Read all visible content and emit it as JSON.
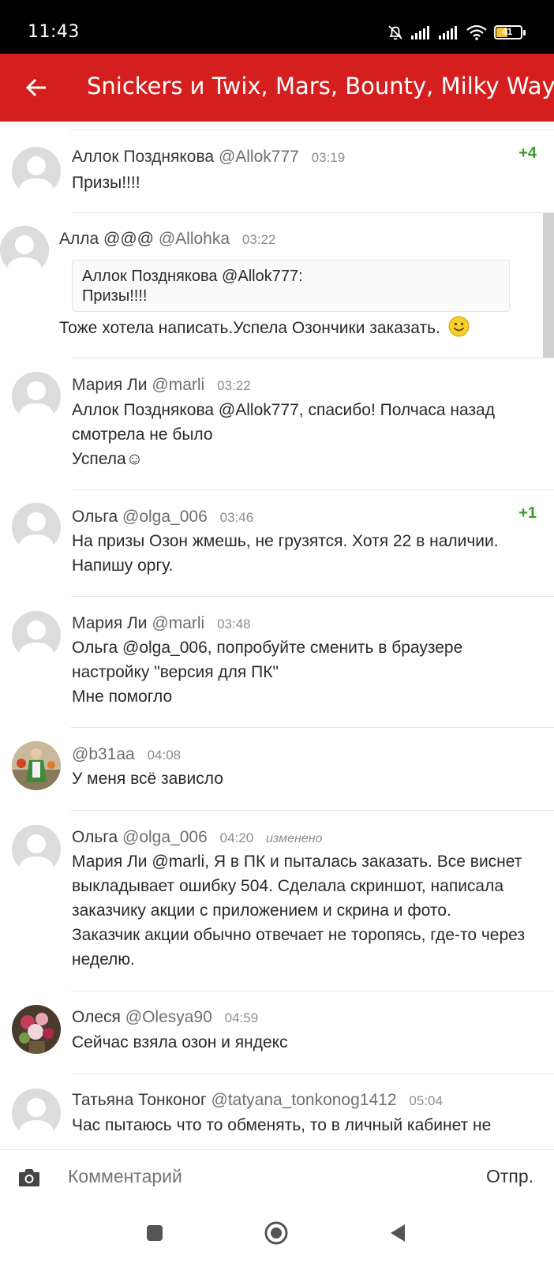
{
  "status_bar": {
    "time": "11:43",
    "battery": "41"
  },
  "header": {
    "title": "Snickers и Twix, Mars, Bounty, Milky Way"
  },
  "comments": [
    {
      "name": "Аллок Позднякова",
      "handle": "@Allok777",
      "time": "03:19",
      "rating": "+4",
      "text": "Призы!!!!"
    },
    {
      "name": "Алла @@@",
      "handle": "@Allohka",
      "time": "03:22",
      "quote": {
        "author": "Аллок Позднякова @Allok777:",
        "text": "Призы!!!!"
      },
      "text": "Тоже хотела написать.Успела Озончики заказать."
    },
    {
      "name": "Мария Ли",
      "handle": "@marli",
      "time": "03:22",
      "lines": [
        "Аллок Позднякова @Allok777, спасибо! Полчаса назад",
        "смотрела не было",
        "Успела☺"
      ]
    },
    {
      "name": "Ольга",
      "handle": "@olga_006",
      "time": "03:46",
      "rating": "+1",
      "lines": [
        "На призы Озон жмешь, не грузятся. Хотя 22 в наличии.",
        "Напишу оргу."
      ]
    },
    {
      "name": "Мария Ли",
      "handle": "@marli",
      "time": "03:48",
      "lines": [
        "Ольга @olga_006, попробуйте сменить в браузере",
        "настройку \"версия для ПК\"",
        "Мне помогло"
      ]
    },
    {
      "name": "",
      "handle": "@b31aa",
      "time": "04:08",
      "text": "У меня всё зависло"
    },
    {
      "name": "Ольга",
      "handle": "@olga_006",
      "time": "04:20",
      "edited": "изменено",
      "lines": [
        "Мария Ли @marli, Я в ПК и пыталась заказать. Все виснет",
        "выкладывает ошибку 504. Сделала скриншот, написала",
        "заказчику акции с приложением и скрина и фото.",
        "Заказчик акции обычно отвечает не торопясь, где-то через",
        "неделю."
      ]
    },
    {
      "name": "Олеся",
      "handle": "@Olesya90",
      "time": "04:59",
      "text": "Сейчас взяла озон и яндекс"
    },
    {
      "name": "Татьяна Тонконог",
      "handle": "@tatyana_tonkonog1412",
      "time": "05:04",
      "text": "Час пытаюсь что то обменять, то в личный кабинет не"
    }
  ],
  "composer": {
    "placeholder": "Комментарий",
    "send_label": "Отпр."
  },
  "colors": {
    "header": "#d51f1f",
    "rating": "#3d9a2d"
  },
  "icons": {
    "back": "arrow-left-icon",
    "camera": "camera-icon",
    "nav": [
      "square-icon",
      "circle-icon",
      "triangle-icon"
    ]
  }
}
